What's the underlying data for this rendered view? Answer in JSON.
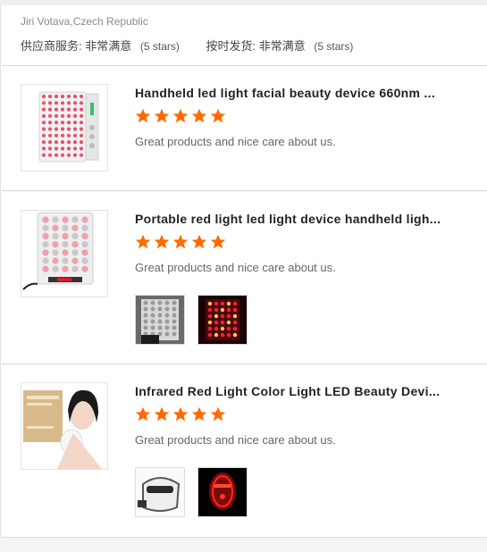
{
  "review": {
    "reviewer": "Jiri Votava,Czech Republic",
    "supplier_service_label": "供应商服务:",
    "supplier_service_value": "非常满意",
    "supplier_service_stars": "(5 stars)",
    "delivery_label": "按时发货:",
    "delivery_value": "非常满意",
    "delivery_stars": "(5 stars)"
  },
  "products": [
    {
      "title": "Handheld led light facial beauty device 660nm ...",
      "rating": 5,
      "comment": "Great products and nice care about us.",
      "photos": 0
    },
    {
      "title": "Portable red light led light device handheld ligh...",
      "rating": 5,
      "comment": "Great products and nice care about us.",
      "photos": 2
    },
    {
      "title": "Infrared Red Light Color Light LED Beauty Devi...",
      "rating": 5,
      "comment": "Great products and nice care about us.",
      "photos": 2
    }
  ],
  "colors": {
    "star": "#ff6a00",
    "title": "#222222",
    "comment": "#666666"
  }
}
